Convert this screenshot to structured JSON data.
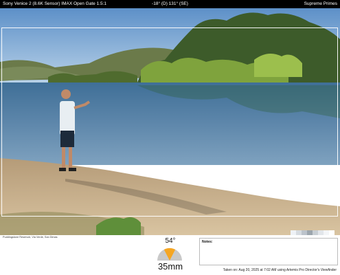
{
  "header": {
    "camera": "Sony Venice 2 (8.6K Sensor) IMAX Open Gate 1.5:1",
    "tilt_heading": "-18° (D) 131° (SE)",
    "lens_set": "Supreme Primes"
  },
  "photo": {
    "description_icon": "lakeside-photo"
  },
  "footer": {
    "location": "Puddingstone Reservoir, Via Verde, San Dimas",
    "angle": "54°",
    "focal_length": "35mm",
    "notes_label": "Notes:",
    "taken_on": "Taken on: Aug 20, 2025 at 7:02 AM using Artemis Pro Director's Viewfinder",
    "gauge_color": "#f5a623",
    "swatch_colors": [
      "#eef2f6",
      "#d6dbe0",
      "#bcc3cb",
      "#9da6ad",
      "#c8ced3",
      "#e2e6ea",
      "#f3f5f7",
      "#ffffff"
    ]
  }
}
